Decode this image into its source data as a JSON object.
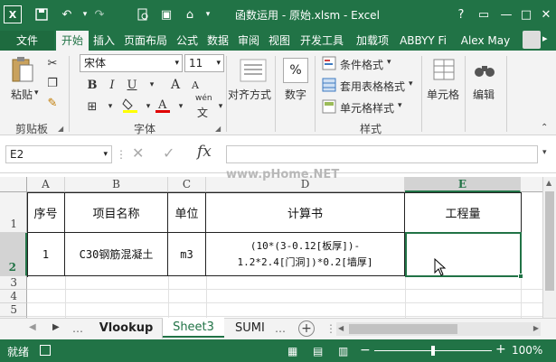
{
  "title": "函数运用 - 原始.xlsm - Excel",
  "window_controls": {
    "help": "?",
    "minimize": "—",
    "restore": "□",
    "close": "✕"
  },
  "tabs": {
    "file": "文件",
    "items": [
      "开始",
      "插入",
      "页面布局",
      "公式",
      "数据",
      "审阅",
      "视图",
      "开发工具",
      "加载项",
      "ABBYY Fi"
    ],
    "user": "Alex May"
  },
  "ribbon": {
    "clipboard": {
      "paste": "粘贴",
      "group": "剪贴板"
    },
    "font": {
      "name": "宋体",
      "size": "11",
      "bold": "B",
      "italic": "I",
      "underline": "U",
      "grow": "A",
      "shrink": "A",
      "phonetic": "wén",
      "group": "字体"
    },
    "alignment": {
      "label": "对齐方式"
    },
    "number": {
      "symbol": "%",
      "label": "数字"
    },
    "styles": {
      "conditional": "条件格式",
      "table": "套用表格格式",
      "cell": "单元格样式",
      "group": "样式"
    },
    "cells": {
      "label": "单元格"
    },
    "editing": {
      "label": "编辑"
    }
  },
  "formula_bar": {
    "name_box": "E2",
    "fx": "fx",
    "watermark": "www.pHome.NET",
    "content": ""
  },
  "columns": [
    "A",
    "B",
    "C",
    "D",
    "E"
  ],
  "rows": [
    "1",
    "2",
    "3",
    "4",
    "5",
    "6"
  ],
  "cells": {
    "a1": "序号",
    "b1": "项目名称",
    "c1": "单位",
    "d1": "计算书",
    "e1": "工程量",
    "a2": "1",
    "b2": "C30钢筋混凝土",
    "c2": "m3",
    "d2_line1": "(10*(3-0.12[板厚])-",
    "d2_line2": "1.2*2.4[门洞])*0.2[墙厚]",
    "e2": ""
  },
  "sheets": {
    "tabs": [
      "Vlookup",
      "Sheet3",
      "SUMI"
    ],
    "active": "Sheet3"
  },
  "status": {
    "ready": "就绪",
    "zoom": "100%"
  },
  "colors": {
    "excel_green": "#217346",
    "ribbon": "#f3f3f3"
  }
}
